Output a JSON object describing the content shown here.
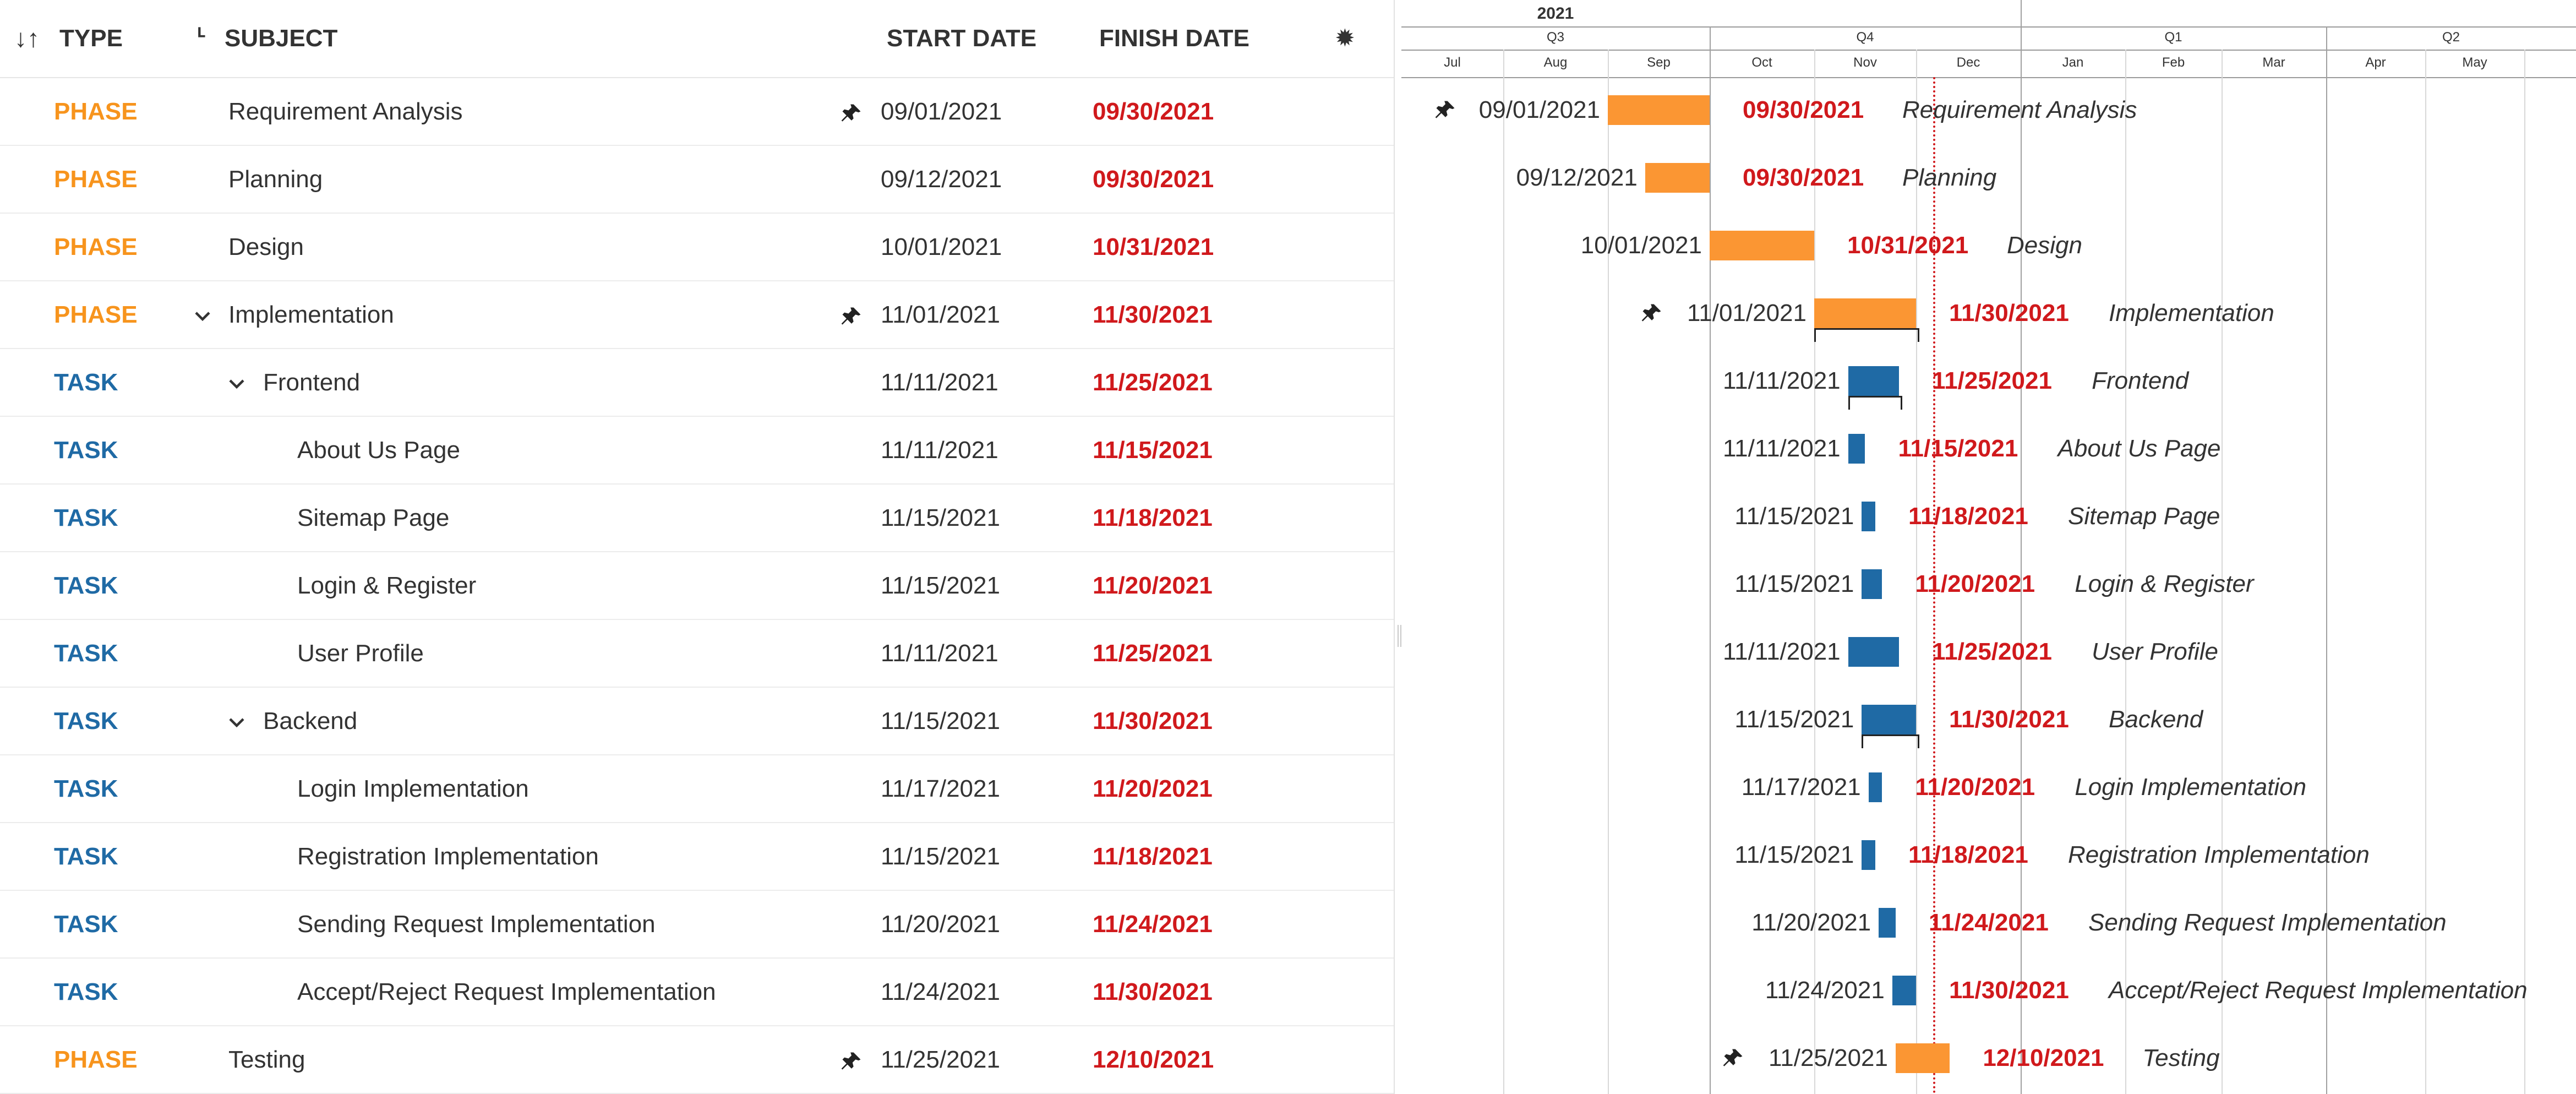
{
  "table": {
    "headers": {
      "type": "TYPE",
      "subject": "SUBJECT",
      "start": "START DATE",
      "finish": "FINISH DATE"
    },
    "rows": [
      {
        "type": "PHASE",
        "subject": "Requirement Analysis",
        "start": "09/01/2021",
        "finish": "09/30/2021",
        "pinned": true,
        "expander": false,
        "level": 0
      },
      {
        "type": "PHASE",
        "subject": "Planning",
        "start": "09/12/2021",
        "finish": "09/30/2021",
        "pinned": false,
        "expander": false,
        "level": 0
      },
      {
        "type": "PHASE",
        "subject": "Design",
        "start": "10/01/2021",
        "finish": "10/31/2021",
        "pinned": false,
        "expander": false,
        "level": 0
      },
      {
        "type": "PHASE",
        "subject": "Implementation",
        "start": "11/01/2021",
        "finish": "11/30/2021",
        "pinned": true,
        "expander": true,
        "level": 0
      },
      {
        "type": "TASK",
        "subject": "Frontend",
        "start": "11/11/2021",
        "finish": "11/25/2021",
        "pinned": false,
        "expander": true,
        "level": 1
      },
      {
        "type": "TASK",
        "subject": "About Us Page",
        "start": "11/11/2021",
        "finish": "11/15/2021",
        "pinned": false,
        "expander": false,
        "level": 2
      },
      {
        "type": "TASK",
        "subject": "Sitemap Page",
        "start": "11/15/2021",
        "finish": "11/18/2021",
        "pinned": false,
        "expander": false,
        "level": 2
      },
      {
        "type": "TASK",
        "subject": "Login & Register",
        "start": "11/15/2021",
        "finish": "11/20/2021",
        "pinned": false,
        "expander": false,
        "level": 2
      },
      {
        "type": "TASK",
        "subject": "User Profile",
        "start": "11/11/2021",
        "finish": "11/25/2021",
        "pinned": false,
        "expander": false,
        "level": 2
      },
      {
        "type": "TASK",
        "subject": "Backend",
        "start": "11/15/2021",
        "finish": "11/30/2021",
        "pinned": false,
        "expander": true,
        "level": 1
      },
      {
        "type": "TASK",
        "subject": "Login Implementation",
        "start": "11/17/2021",
        "finish": "11/20/2021",
        "pinned": false,
        "expander": false,
        "level": 2
      },
      {
        "type": "TASK",
        "subject": "Registration Implementation",
        "start": "11/15/2021",
        "finish": "11/18/2021",
        "pinned": false,
        "expander": false,
        "level": 2
      },
      {
        "type": "TASK",
        "subject": "Sending Request Implementation",
        "start": "11/20/2021",
        "finish": "11/24/2021",
        "pinned": false,
        "expander": false,
        "level": 2
      },
      {
        "type": "TASK",
        "subject": "Accept/Reject Request Implementation",
        "start": "11/24/2021",
        "finish": "11/30/2021",
        "pinned": false,
        "expander": false,
        "level": 2
      },
      {
        "type": "PHASE",
        "subject": "Testing",
        "start": "11/25/2021",
        "finish": "12/10/2021",
        "pinned": true,
        "expander": false,
        "level": 0
      }
    ]
  },
  "timescale": {
    "year": "2021",
    "quarters": [
      "Q3",
      "Q4",
      "Q1",
      "Q2"
    ],
    "months": [
      "Jul",
      "Aug",
      "Sep",
      "Oct",
      "Nov",
      "Dec",
      "Jan",
      "Feb",
      "Mar",
      "Apr",
      "May"
    ]
  },
  "today_marker": "12/06/2021",
  "colors": {
    "phase": "#f7941d",
    "task": "#1f6aa5",
    "finish_date": "#d0191c",
    "phase_bar": "#fb9633",
    "task_bar": "#1f6aa5"
  },
  "icons": {
    "sort": "sort-arrows-icon",
    "tree": "tree-icon",
    "settings": "gear-icon",
    "pin": "pin-icon",
    "expand": "chevron-down-icon"
  }
}
